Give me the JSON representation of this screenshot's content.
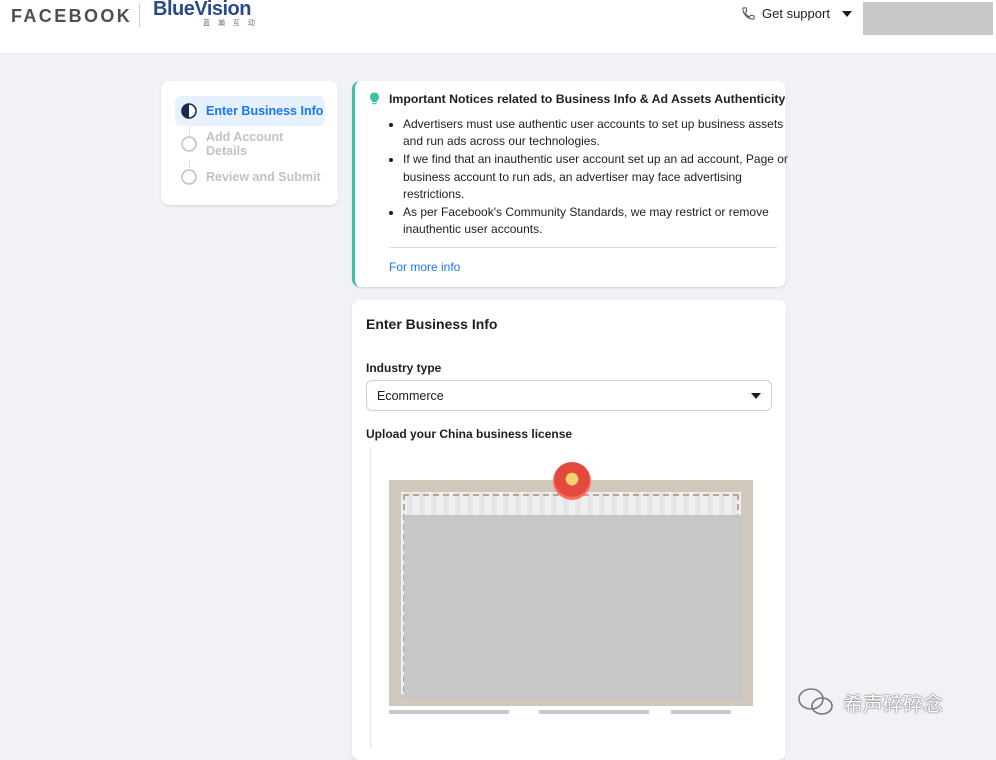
{
  "header": {
    "facebook_logo": "FACEBOOK",
    "partner_logo_main": "BlueVision",
    "partner_logo_sub": "蓝 瀚 互 动",
    "support_label": "Get support"
  },
  "steps": [
    {
      "label": "Enter Business Info",
      "state": "active"
    },
    {
      "label": "Add Account Details",
      "state": "pending"
    },
    {
      "label": "Review and Submit",
      "state": "pending"
    }
  ],
  "notice": {
    "title": "Important Notices related to Business Info & Ad Assets Authenticity",
    "items": [
      "Advertisers must use authentic user accounts to set up business assets and run ads across our technologies.",
      "If we find that an inauthentic user account set up an ad account, Page or business account to run ads, an advertiser may face advertising restrictions.",
      "As per Facebook's Community Standards, we may restrict or remove inauthentic user accounts."
    ],
    "link_label": "For more info",
    "accent_color": "#3cc2a0"
  },
  "form": {
    "title": "Enter Business Info",
    "industry_label": "Industry type",
    "industry_value": "Ecommerce",
    "upload_label": "Upload your China business license"
  },
  "watermark": {
    "text": "希声碎碎念"
  },
  "colors": {
    "brand_blue": "#1877f2",
    "page_bg": "#f0f2f5"
  }
}
